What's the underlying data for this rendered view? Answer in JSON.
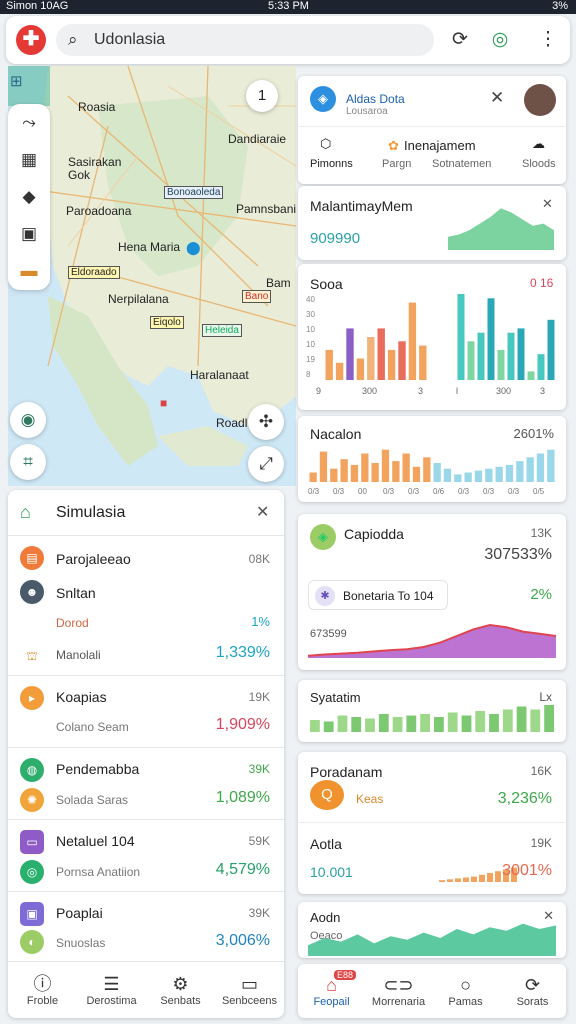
{
  "status": {
    "left": "Simon 10AG",
    "time": "5:33 PM",
    "right": "3%"
  },
  "topbar": {
    "logo": "✚",
    "search_value": "Udonlasia",
    "refresh_icon": "refresh-icon",
    "target_icon": "target-icon",
    "more_icon": "more-vert-icon"
  },
  "map": {
    "layer_icon": "grid-icon",
    "zoom_level": "1",
    "labels": [
      "Roasia",
      "Dandiaraie",
      "Sasirakan Gok",
      "Paroadoana",
      "Pamnsbania",
      "Hena Maria",
      "Nerpilalana",
      "Haralanaat",
      "Roadl",
      "Bam"
    ],
    "roads": [
      "Bonoaoleda",
      "Eldoraado",
      "Eiqolo",
      "Heleida",
      "Bano"
    ],
    "tools": [
      "route-icon",
      "chart-icon",
      "tag-icon",
      "layers-icon",
      "storage-icon"
    ],
    "side_buttons": [
      "location-icon",
      "share-icon"
    ],
    "right_buttons": [
      "compass-icon",
      "expand-icon"
    ]
  },
  "sim": {
    "title": "Simulasia",
    "rows": [
      {
        "name": "Parojaleeao",
        "value": "08K",
        "icon_color": "#ef7b3a"
      },
      {
        "name": "Snltan"
      },
      {
        "sub": "Dorod",
        "value": "1%"
      },
      {
        "sub": "Manolali",
        "pct": "1,339%",
        "pct_color": "#1ba3c6"
      },
      {
        "name": "Koapias",
        "value": "19K",
        "sub": "Colano Seam",
        "pct": "1,909%",
        "pct_color": "#d6455b",
        "icon_color": "#f39c3a"
      },
      {
        "name": "Pendemabba",
        "value": "39K",
        "sub": "Solada Saras",
        "pct": "1,089%",
        "pct_color": "#3fa84a",
        "icon_color": "#2eae6d",
        "icon2_color": "#f0a43a"
      },
      {
        "name": "Netaluel 104",
        "value": "59K",
        "sub": "Pornsa Anatiion",
        "pct": "4,579%",
        "pct_color": "#27a06a",
        "icon_color": "#8e5bc7",
        "icon2_color": "#29b06d"
      },
      {
        "name": "Poaplai",
        "value": "39K",
        "sub": "Snuoslas",
        "pct": "3,006%",
        "pct_color": "#1e84c0",
        "icon_color": "#7f6bd6",
        "icon2_color": "#9ccc65"
      }
    ],
    "nav": [
      {
        "label": "Froble",
        "icon": "info-icon"
      },
      {
        "label": "Derostima",
        "icon": "list-icon"
      },
      {
        "label": "Senbats",
        "icon": "settings-icon"
      },
      {
        "label": "Senbceens",
        "icon": "monitor-icon"
      }
    ]
  },
  "right": {
    "profile": {
      "title": "Aldas Dota",
      "subtitle": "Lousaroa",
      "tabs": [
        {
          "label": "Pimonns",
          "icon": "cube-icon"
        },
        {
          "label": "Pargn",
          "top": "Inenajamem",
          "icon": "flower-icon"
        },
        {
          "label": "Sotnatemen"
        },
        {
          "label": "Sloods",
          "icon": "cloud-icon"
        }
      ]
    },
    "card1": {
      "title": "MalantimayMem",
      "value": "909990",
      "area": [
        0.3,
        0.35,
        0.45,
        0.6,
        0.75,
        0.95,
        0.85,
        0.7,
        0.55,
        0.6,
        0.45
      ]
    },
    "card2": {
      "title": "Sooa",
      "badge": "0 16",
      "bars_left": [
        0.35,
        0.2,
        0.6,
        0.25,
        0.5,
        0.6,
        0.35,
        0.45,
        0.9,
        0.4
      ],
      "bars_right": [
        1.0,
        0.45,
        0.55,
        0.95,
        0.35,
        0.55,
        0.6,
        0.1,
        0.3,
        0.7
      ],
      "yticks": [
        "40",
        "30",
        "10",
        "10",
        "19",
        "8"
      ],
      "xlabels": [
        "9",
        "300",
        "3",
        "l",
        "300",
        "3"
      ]
    },
    "card3": {
      "title": "Nacalon",
      "value": "2601%",
      "bars": [
        0.25,
        0.8,
        0.35,
        0.6,
        0.45,
        0.75,
        0.5,
        0.85,
        0.55,
        0.75,
        0.4,
        0.65,
        0.5,
        0.35,
        0.2,
        0.25,
        0.3,
        0.35,
        0.4,
        0.45,
        0.55,
        0.65,
        0.75,
        0.85
      ],
      "xlabels": [
        "0/3",
        "0/3",
        "00",
        "0/3",
        "0/3",
        "0/6",
        "0/3",
        "0/3",
        "0/3",
        "0/5"
      ]
    },
    "card4": {
      "title": "Capiodda",
      "value1": "13K",
      "big": "307533%",
      "tag": "Bonetaria To 104",
      "tag_pct": "2%",
      "small": "673599",
      "area": [
        0.05,
        0.08,
        0.1,
        0.12,
        0.15,
        0.18,
        0.2,
        0.25,
        0.35,
        0.5,
        0.65,
        0.75,
        0.7,
        0.6,
        0.55,
        0.5
      ]
    },
    "card5": {
      "title": "Syatatim",
      "value": "Lx",
      "bars": [
        0.4,
        0.35,
        0.55,
        0.5,
        0.45,
        0.6,
        0.5,
        0.55,
        0.6,
        0.5,
        0.65,
        0.55,
        0.7,
        0.6,
        0.75,
        0.85,
        0.75,
        0.9
      ]
    },
    "card6": {
      "title": "Poradanam",
      "value": "16K",
      "label": "Keas",
      "pct": "3,236%"
    },
    "card7": {
      "title": "Aotla",
      "value": "19K",
      "small": "10.001",
      "pct": "3001%",
      "bars": [
        0.1,
        0.15,
        0.2,
        0.25,
        0.3,
        0.4,
        0.5,
        0.6,
        0.7,
        0.8
      ]
    },
    "card8": {
      "title": "Aodn",
      "small": "Oeaco",
      "area": [
        0.3,
        0.5,
        0.4,
        0.6,
        0.35,
        0.55,
        0.45,
        0.65,
        0.5,
        0.75,
        0.6,
        0.8,
        0.7,
        0.9,
        0.75,
        0.85
      ]
    },
    "nav": [
      {
        "label": "Feopail",
        "icon": "home-icon",
        "badge": "E88"
      },
      {
        "label": "Morrenaria",
        "icon": "link-icon"
      },
      {
        "label": "Pamas",
        "icon": "circle-icon"
      },
      {
        "label": "Sorats",
        "icon": "refresh-icon"
      }
    ]
  }
}
